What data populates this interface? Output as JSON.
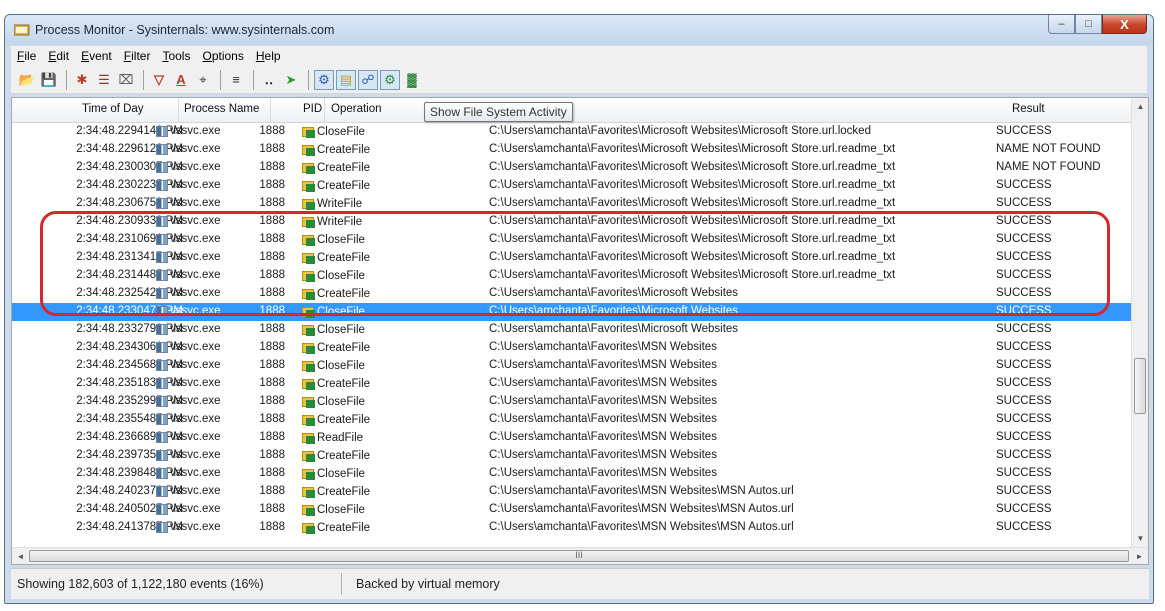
{
  "window": {
    "title": "Process Monitor - Sysinternals: www.sysinternals.com",
    "minimize_glyph": "–",
    "maximize_glyph": "□",
    "close_glyph": "X"
  },
  "menu": [
    {
      "accel": "F",
      "rest": "ile"
    },
    {
      "accel": "E",
      "rest": "dit"
    },
    {
      "accel": "E",
      "rest": "vent"
    },
    {
      "accel": "F",
      "rest": "ilter"
    },
    {
      "accel": "T",
      "rest": "ools"
    },
    {
      "accel": "O",
      "rest": "ptions"
    },
    {
      "accel": "H",
      "rest": "elp"
    }
  ],
  "toolbar": {
    "open_glyph": "📂",
    "save_glyph": "💾",
    "capture_glyph": "✱",
    "autoscroll_glyph": "☰",
    "clear_glyph": "⌧",
    "filter_glyph": "▽",
    "highlight_glyph": "A",
    "target_glyph": "⌖",
    "tree_glyph": "≡",
    "find_glyph": "‥",
    "jump_glyph": "➤",
    "registry_glyph": "⚙",
    "filesystem_glyph": "▤",
    "network_glyph": "☍",
    "process_glyph": "⚙",
    "profiling_glyph": "▓"
  },
  "columns": {
    "time": "Time of Day",
    "process": "Process Name",
    "pid": "PID",
    "operation": "Operation",
    "result": "Result"
  },
  "tooltip": "Show File System Activity",
  "events": [
    {
      "time": "2:34:48.2294142 PM",
      "process": "vssvc.exe",
      "pid": "1888",
      "op": "CloseFile",
      "path": "C:\\Users\\amchanta\\Favorites\\Microsoft Websites\\Microsoft Store.url.locked",
      "result": "SUCCESS"
    },
    {
      "time": "2:34:48.2296120 PM",
      "process": "vssvc.exe",
      "pid": "1888",
      "op": "CreateFile",
      "path": "C:\\Users\\amchanta\\Favorites\\Microsoft Websites\\Microsoft Store.url.readme_txt",
      "result": "NAME NOT FOUND"
    },
    {
      "time": "2:34:48.2300307 PM",
      "process": "vssvc.exe",
      "pid": "1888",
      "op": "CreateFile",
      "path": "C:\\Users\\amchanta\\Favorites\\Microsoft Websites\\Microsoft Store.url.readme_txt",
      "result": "NAME NOT FOUND"
    },
    {
      "time": "2:34:48.2302235 PM",
      "process": "vssvc.exe",
      "pid": "1888",
      "op": "CreateFile",
      "path": "C:\\Users\\amchanta\\Favorites\\Microsoft Websites\\Microsoft Store.url.readme_txt",
      "result": "SUCCESS"
    },
    {
      "time": "2:34:48.2306759 PM",
      "process": "vssvc.exe",
      "pid": "1888",
      "op": "WriteFile",
      "path": "C:\\Users\\amchanta\\Favorites\\Microsoft Websites\\Microsoft Store.url.readme_txt",
      "result": "SUCCESS"
    },
    {
      "time": "2:34:48.2309330 PM",
      "process": "vssvc.exe",
      "pid": "1888",
      "op": "WriteFile",
      "path": "C:\\Users\\amchanta\\Favorites\\Microsoft Websites\\Microsoft Store.url.readme_txt",
      "result": "SUCCESS"
    },
    {
      "time": "2:34:48.2310691 PM",
      "process": "vssvc.exe",
      "pid": "1888",
      "op": "CloseFile",
      "path": "C:\\Users\\amchanta\\Favorites\\Microsoft Websites\\Microsoft Store.url.readme_txt",
      "result": "SUCCESS"
    },
    {
      "time": "2:34:48.2313415 PM",
      "process": "vssvc.exe",
      "pid": "1888",
      "op": "CreateFile",
      "path": "C:\\Users\\amchanta\\Favorites\\Microsoft Websites\\Microsoft Store.url.readme_txt",
      "result": "SUCCESS"
    },
    {
      "time": "2:34:48.2314485 PM",
      "process": "vssvc.exe",
      "pid": "1888",
      "op": "CloseFile",
      "path": "C:\\Users\\amchanta\\Favorites\\Microsoft Websites\\Microsoft Store.url.readme_txt",
      "result": "SUCCESS"
    },
    {
      "time": "2:34:48.2325421 PM",
      "process": "vssvc.exe",
      "pid": "1888",
      "op": "CreateFile",
      "path": "C:\\Users\\amchanta\\Favorites\\Microsoft Websites",
      "result": "SUCCESS"
    },
    {
      "time": "2:34:48.2330478 PM",
      "process": "vssvc.exe",
      "pid": "1888",
      "op": "CloseFile",
      "path": "C:\\Users\\amchanta\\Favorites\\Microsoft Websites",
      "result": "SUCCESS",
      "selected": true
    },
    {
      "time": "2:34:48.2332799 PM",
      "process": "vssvc.exe",
      "pid": "1888",
      "op": "CloseFile",
      "path": "C:\\Users\\amchanta\\Favorites\\Microsoft Websites",
      "result": "SUCCESS"
    },
    {
      "time": "2:34:48.2343061 PM",
      "process": "vssvc.exe",
      "pid": "1888",
      "op": "CreateFile",
      "path": "C:\\Users\\amchanta\\Favorites\\MSN Websites",
      "result": "SUCCESS"
    },
    {
      "time": "2:34:48.2345685 PM",
      "process": "vssvc.exe",
      "pid": "1888",
      "op": "CloseFile",
      "path": "C:\\Users\\amchanta\\Favorites\\MSN Websites",
      "result": "SUCCESS"
    },
    {
      "time": "2:34:48.2351833 PM",
      "process": "vssvc.exe",
      "pid": "1888",
      "op": "CreateFile",
      "path": "C:\\Users\\amchanta\\Favorites\\MSN Websites",
      "result": "SUCCESS"
    },
    {
      "time": "2:34:48.2352995 PM",
      "process": "vssvc.exe",
      "pid": "1888",
      "op": "CloseFile",
      "path": "C:\\Users\\amchanta\\Favorites\\MSN Websites",
      "result": "SUCCESS"
    },
    {
      "time": "2:34:48.2355487 PM",
      "process": "vssvc.exe",
      "pid": "1888",
      "op": "CreateFile",
      "path": "C:\\Users\\amchanta\\Favorites\\MSN Websites",
      "result": "SUCCESS"
    },
    {
      "time": "2:34:48.2366898 PM",
      "process": "vssvc.exe",
      "pid": "1888",
      "op": "ReadFile",
      "path": "C:\\Users\\amchanta\\Favorites\\MSN Websites",
      "result": "SUCCESS"
    },
    {
      "time": "2:34:48.2397354 PM",
      "process": "vssvc.exe",
      "pid": "1888",
      "op": "CreateFile",
      "path": "C:\\Users\\amchanta\\Favorites\\MSN Websites",
      "result": "SUCCESS"
    },
    {
      "time": "2:34:48.2398480 PM",
      "process": "vssvc.exe",
      "pid": "1888",
      "op": "CloseFile",
      "path": "C:\\Users\\amchanta\\Favorites\\MSN Websites",
      "result": "SUCCESS"
    },
    {
      "time": "2:34:48.2402376 PM",
      "process": "vssvc.exe",
      "pid": "1888",
      "op": "CreateFile",
      "path": "C:\\Users\\amchanta\\Favorites\\MSN Websites\\MSN Autos.url",
      "result": "SUCCESS"
    },
    {
      "time": "2:34:48.2405027 PM",
      "process": "vssvc.exe",
      "pid": "1888",
      "op": "CloseFile",
      "path": "C:\\Users\\amchanta\\Favorites\\MSN Websites\\MSN Autos.url",
      "result": "SUCCESS"
    },
    {
      "time": "2:34:48.2413787 PM",
      "process": "vssvc.exe",
      "pid": "1888",
      "op": "CreateFile",
      "path": "C:\\Users\\amchanta\\Favorites\\MSN Websites\\MSN Autos.url",
      "result": "SUCCESS"
    }
  ],
  "scroll": {
    "up_glyph": "▲",
    "down_glyph": "▼",
    "left_glyph": "◄",
    "right_glyph": "►",
    "grip_glyph": "III"
  },
  "status": {
    "events": "Showing 182,603 of 1,122,180 events (16%)",
    "memory": "Backed by virtual memory"
  },
  "colors": {
    "selection": "#3399ff",
    "annotation": "#d9262a"
  }
}
